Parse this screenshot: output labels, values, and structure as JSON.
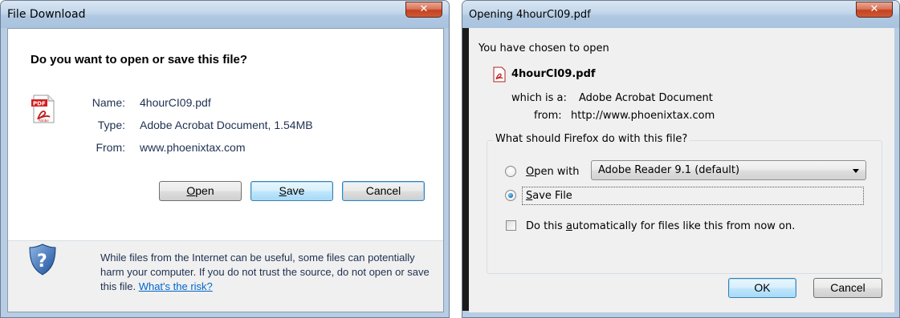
{
  "file_download": {
    "title": "File Download",
    "question": "Do you want to open or save this file?",
    "fields": [
      {
        "label": "Name:",
        "value": "4hourCI09.pdf"
      },
      {
        "label": "Type:",
        "value": "Adobe Acrobat Document, 1.54MB"
      },
      {
        "label": "From:",
        "value": "www.phoenixtax.com"
      }
    ],
    "buttons": {
      "open_mnemonic": "O",
      "open_rest": "pen",
      "save_mnemonic": "S",
      "save_rest": "ave",
      "cancel": "Cancel"
    },
    "warning": "While files from the Internet can be useful, some files can potentially harm your computer. If you do not trust the source, do not open or save this file.",
    "warning_link": "What's the risk?",
    "icons": {
      "file": "pdf-file-icon",
      "warning": "shield-question-icon",
      "close": "close-icon"
    }
  },
  "firefox_dialog": {
    "title": "Opening 4hourCI09.pdf",
    "chosen_text": "You have chosen to open",
    "file_name": "4hourCI09.pdf",
    "which_is_label": "which is a:",
    "which_is_value": "Adobe Acrobat Document",
    "from_label": "from:",
    "from_value": "http://www.phoenixtax.com",
    "group_label": "What should Firefox do with this file?",
    "open_with_mnemonic": "O",
    "open_with_rest": "pen with",
    "open_with_app": "Adobe Reader 9.1 (default)",
    "save_file_mnemonic": "S",
    "save_file_rest": "ave File",
    "auto_prefix": "Do this ",
    "auto_mnemonic": "a",
    "auto_rest": "utomatically for files like this from now on.",
    "selected_option": "save_file",
    "auto_checked": false,
    "ok": "OK",
    "cancel": "Cancel",
    "icons": {
      "file": "pdf-file-icon",
      "close": "close-icon",
      "dropdown": "chevron-down-icon"
    }
  },
  "colors": {
    "link": "#0066cc",
    "title_bar": "#b0c8e2",
    "close_button": "#c4421f",
    "dialog_bg": "#f0f0f0"
  }
}
